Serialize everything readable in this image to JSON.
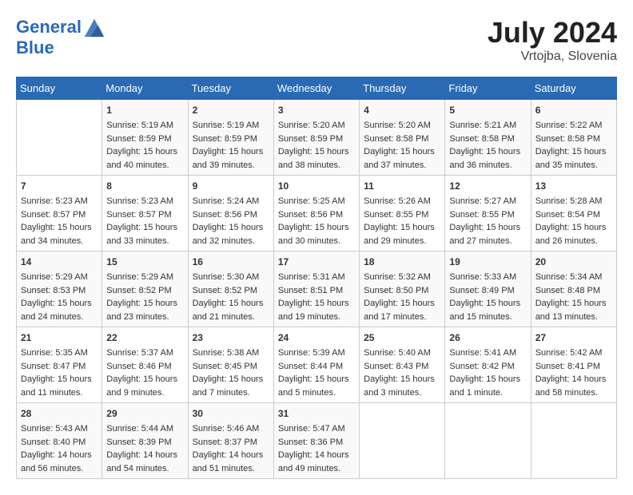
{
  "header": {
    "logo_line1": "General",
    "logo_line2": "Blue",
    "month_year": "July 2024",
    "location": "Vrtojba, Slovenia"
  },
  "weekdays": [
    "Sunday",
    "Monday",
    "Tuesday",
    "Wednesday",
    "Thursday",
    "Friday",
    "Saturday"
  ],
  "weeks": [
    [
      {
        "day": "",
        "info": ""
      },
      {
        "day": "1",
        "info": "Sunrise: 5:19 AM\nSunset: 8:59 PM\nDaylight: 15 hours\nand 40 minutes."
      },
      {
        "day": "2",
        "info": "Sunrise: 5:19 AM\nSunset: 8:59 PM\nDaylight: 15 hours\nand 39 minutes."
      },
      {
        "day": "3",
        "info": "Sunrise: 5:20 AM\nSunset: 8:59 PM\nDaylight: 15 hours\nand 38 minutes."
      },
      {
        "day": "4",
        "info": "Sunrise: 5:20 AM\nSunset: 8:58 PM\nDaylight: 15 hours\nand 37 minutes."
      },
      {
        "day": "5",
        "info": "Sunrise: 5:21 AM\nSunset: 8:58 PM\nDaylight: 15 hours\nand 36 minutes."
      },
      {
        "day": "6",
        "info": "Sunrise: 5:22 AM\nSunset: 8:58 PM\nDaylight: 15 hours\nand 35 minutes."
      }
    ],
    [
      {
        "day": "7",
        "info": "Sunrise: 5:23 AM\nSunset: 8:57 PM\nDaylight: 15 hours\nand 34 minutes."
      },
      {
        "day": "8",
        "info": "Sunrise: 5:23 AM\nSunset: 8:57 PM\nDaylight: 15 hours\nand 33 minutes."
      },
      {
        "day": "9",
        "info": "Sunrise: 5:24 AM\nSunset: 8:56 PM\nDaylight: 15 hours\nand 32 minutes."
      },
      {
        "day": "10",
        "info": "Sunrise: 5:25 AM\nSunset: 8:56 PM\nDaylight: 15 hours\nand 30 minutes."
      },
      {
        "day": "11",
        "info": "Sunrise: 5:26 AM\nSunset: 8:55 PM\nDaylight: 15 hours\nand 29 minutes."
      },
      {
        "day": "12",
        "info": "Sunrise: 5:27 AM\nSunset: 8:55 PM\nDaylight: 15 hours\nand 27 minutes."
      },
      {
        "day": "13",
        "info": "Sunrise: 5:28 AM\nSunset: 8:54 PM\nDaylight: 15 hours\nand 26 minutes."
      }
    ],
    [
      {
        "day": "14",
        "info": "Sunrise: 5:29 AM\nSunset: 8:53 PM\nDaylight: 15 hours\nand 24 minutes."
      },
      {
        "day": "15",
        "info": "Sunrise: 5:29 AM\nSunset: 8:52 PM\nDaylight: 15 hours\nand 23 minutes."
      },
      {
        "day": "16",
        "info": "Sunrise: 5:30 AM\nSunset: 8:52 PM\nDaylight: 15 hours\nand 21 minutes."
      },
      {
        "day": "17",
        "info": "Sunrise: 5:31 AM\nSunset: 8:51 PM\nDaylight: 15 hours\nand 19 minutes."
      },
      {
        "day": "18",
        "info": "Sunrise: 5:32 AM\nSunset: 8:50 PM\nDaylight: 15 hours\nand 17 minutes."
      },
      {
        "day": "19",
        "info": "Sunrise: 5:33 AM\nSunset: 8:49 PM\nDaylight: 15 hours\nand 15 minutes."
      },
      {
        "day": "20",
        "info": "Sunrise: 5:34 AM\nSunset: 8:48 PM\nDaylight: 15 hours\nand 13 minutes."
      }
    ],
    [
      {
        "day": "21",
        "info": "Sunrise: 5:35 AM\nSunset: 8:47 PM\nDaylight: 15 hours\nand 11 minutes."
      },
      {
        "day": "22",
        "info": "Sunrise: 5:37 AM\nSunset: 8:46 PM\nDaylight: 15 hours\nand 9 minutes."
      },
      {
        "day": "23",
        "info": "Sunrise: 5:38 AM\nSunset: 8:45 PM\nDaylight: 15 hours\nand 7 minutes."
      },
      {
        "day": "24",
        "info": "Sunrise: 5:39 AM\nSunset: 8:44 PM\nDaylight: 15 hours\nand 5 minutes."
      },
      {
        "day": "25",
        "info": "Sunrise: 5:40 AM\nSunset: 8:43 PM\nDaylight: 15 hours\nand 3 minutes."
      },
      {
        "day": "26",
        "info": "Sunrise: 5:41 AM\nSunset: 8:42 PM\nDaylight: 15 hours\nand 1 minute."
      },
      {
        "day": "27",
        "info": "Sunrise: 5:42 AM\nSunset: 8:41 PM\nDaylight: 14 hours\nand 58 minutes."
      }
    ],
    [
      {
        "day": "28",
        "info": "Sunrise: 5:43 AM\nSunset: 8:40 PM\nDaylight: 14 hours\nand 56 minutes."
      },
      {
        "day": "29",
        "info": "Sunrise: 5:44 AM\nSunset: 8:39 PM\nDaylight: 14 hours\nand 54 minutes."
      },
      {
        "day": "30",
        "info": "Sunrise: 5:46 AM\nSunset: 8:37 PM\nDaylight: 14 hours\nand 51 minutes."
      },
      {
        "day": "31",
        "info": "Sunrise: 5:47 AM\nSunset: 8:36 PM\nDaylight: 14 hours\nand 49 minutes."
      },
      {
        "day": "",
        "info": ""
      },
      {
        "day": "",
        "info": ""
      },
      {
        "day": "",
        "info": ""
      }
    ]
  ]
}
